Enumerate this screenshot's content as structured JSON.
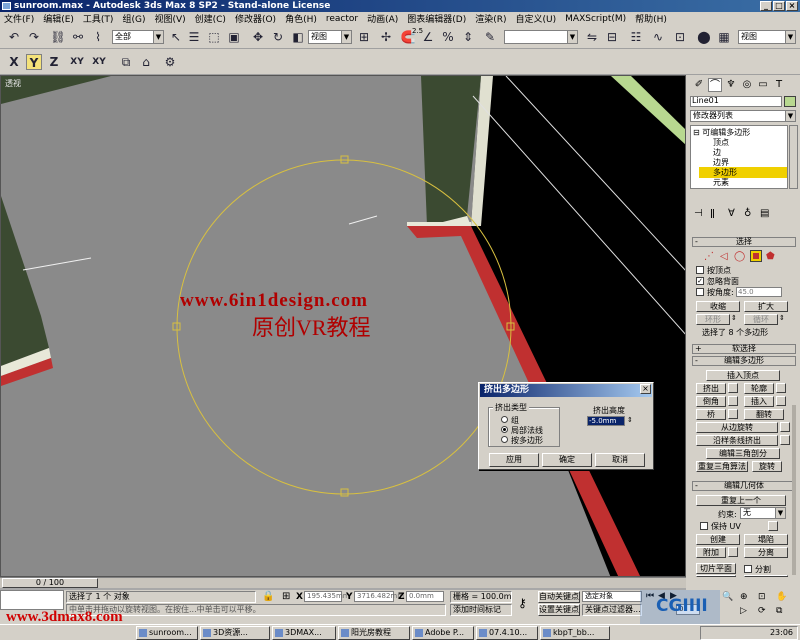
{
  "window": {
    "title": "sunroom.max - Autodesk 3ds Max 8 SP2 - Stand-alone License",
    "minimize_glyph": "_",
    "maximize_glyph": "□",
    "close_glyph": "×"
  },
  "menu": {
    "items": [
      "文件(F)",
      "编辑(E)",
      "工具(T)",
      "组(G)",
      "视图(V)",
      "创建(C)",
      "修改器(O)",
      "角色(H)",
      "reactor",
      "动画(A)",
      "图表编辑器(D)",
      "渲染(R)",
      "自定义(U)",
      "MAXScript(M)",
      "帮助(H)"
    ]
  },
  "toolbar": {
    "selection_filter": "全部",
    "ref_coord": "视图",
    "named_selection": "",
    "view_combo": "视图",
    "axis_x": "X",
    "axis_y": "Y",
    "axis_z": "Z",
    "axis_xy": "XY",
    "axis_xy2": "XY",
    "snap_angle": "2.5",
    "snap_percent": "%"
  },
  "viewport": {
    "label": "透视"
  },
  "panel": {
    "object_name": "Line01",
    "modifier_list": "修改器列表",
    "stack": {
      "root": "可编辑多边形",
      "items": [
        "顶点",
        "边",
        "边界",
        "多边形",
        "元素"
      ],
      "selected": "多边形"
    },
    "select_rollout": {
      "title": "选择",
      "by_vertex": "按顶点",
      "ignore_backface": "忽略背面",
      "by_angle": "按角度:",
      "angle_value": "45.0",
      "shrink": "收缩",
      "grow": "扩大",
      "ring": "环形",
      "loop": "循环",
      "status": "选择了 8 个多边形"
    },
    "soft_select_title": "软选择",
    "edit_poly_rollout": {
      "title": "编辑多边形",
      "insert_vertex": "插入顶点",
      "extrude": "挤出",
      "outline": "轮廓",
      "bevel": "倒角",
      "inset": "插入",
      "bridge": "桥",
      "flip": "翻转",
      "hinge": "从边旋转",
      "extrude_spline": "沿样条线挤出",
      "edit_tri": "编辑三角剖分",
      "retriangulate": "重复三角算法",
      "turn": "旋转"
    },
    "edit_geom_rollout": {
      "title": "编辑几何体",
      "repeat_last": "重复上一个",
      "constraints_label": "约束:",
      "constraints_value": "无",
      "preserve_uv": "保持 UV",
      "create": "创建",
      "collapse": "塌陷",
      "attach": "附加",
      "detach": "分离",
      "slice_plane": "切片平面",
      "split": "分割",
      "slice": "切片",
      "reset_plane": "重置平面"
    },
    "plus": "+",
    "minus": "-"
  },
  "dialog": {
    "title": "挤出多边形",
    "group_type": "挤出类型",
    "opt_group": "组",
    "opt_local": "局部法线",
    "opt_by_poly": "按多边形",
    "height_label": "挤出高度",
    "height_value": "-5.0mm",
    "apply": "应用",
    "ok": "确定",
    "cancel": "取消",
    "selected_option": "局部法线"
  },
  "timeline": {
    "frame": "0 / 100"
  },
  "status": {
    "selection": "选择了 1 个 对象",
    "prompt": "中单击并拖动以旋转视图。在按住...中单击可以平移。",
    "prompt2": "单击或单击并拖动以选择对象",
    "x_label": "X",
    "x_value": "195.435mm",
    "y_label": "Y",
    "y_value": "3716.482mm",
    "z_label": "Z",
    "z_value": "0.0mm",
    "grid": "栅格 = 100.0mm",
    "add_time_tag": "添加时间标记",
    "autokey": "自动关键点",
    "setkey": "设置关键点",
    "selected_obj": "选定对象",
    "key_filters": "关键点过滤器...",
    "frame_spinner": "0",
    "time_cfg": "中单击并拖动以旋转视图"
  },
  "taskbar": {
    "items": [
      "sunroom...",
      "3D资源...",
      "3DMAX...",
      "阳光房教程",
      "Adobe P...",
      "07.4.10...",
      "kbpT_bb..."
    ],
    "clock": "23:06"
  },
  "watermarks": {
    "site": "www.6in1design.com",
    "course": "原创VR教程",
    "bottom": "www.3dmax8.com",
    "logo": "CGIIII"
  },
  "colors": {
    "viewport_bg": "#8a8a8a",
    "wall_green": "#3b4a31",
    "selected_red": "#c03030",
    "gizmo_yellow": "#d8c040",
    "stack_highlight": "#f0d000"
  }
}
